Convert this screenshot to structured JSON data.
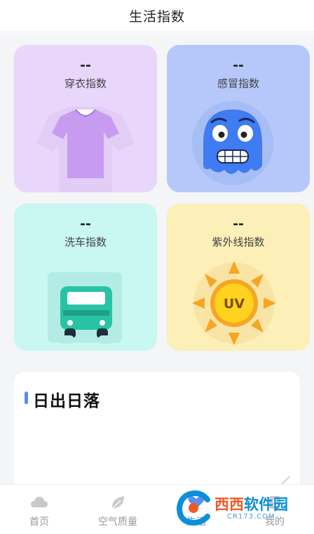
{
  "header": {
    "title": "生活指数"
  },
  "cards": [
    {
      "value": "--",
      "label": "穿衣指数",
      "icon": "shirt-icon"
    },
    {
      "value": "--",
      "label": "感冒指数",
      "icon": "cold-face-icon"
    },
    {
      "value": "--",
      "label": "洗车指数",
      "icon": "car-icon"
    },
    {
      "value": "--",
      "label": "紫外线指数",
      "icon": "sun-uv-icon",
      "badge": "UV"
    }
  ],
  "sunrise": {
    "title": "日出日落"
  },
  "tabs": [
    {
      "label": "首页",
      "icon": "cloud-icon",
      "active": false
    },
    {
      "label": "空气质量",
      "icon": "leaf-icon",
      "active": false
    },
    {
      "label": "生活",
      "icon": "heart-icon",
      "active": true
    },
    {
      "label": "我的",
      "icon": "profile-icon",
      "active": false
    }
  ],
  "watermark": {
    "cn_a": "西西",
    "cn_b": "软件园",
    "en": "CR173.COM"
  },
  "colors": {
    "dress_bg": "#e9d6fb",
    "cold_bg": "#b5c8f9",
    "wash_bg": "#c9f7f1",
    "uv_bg": "#fcefb8",
    "accent": "#5b8def"
  }
}
